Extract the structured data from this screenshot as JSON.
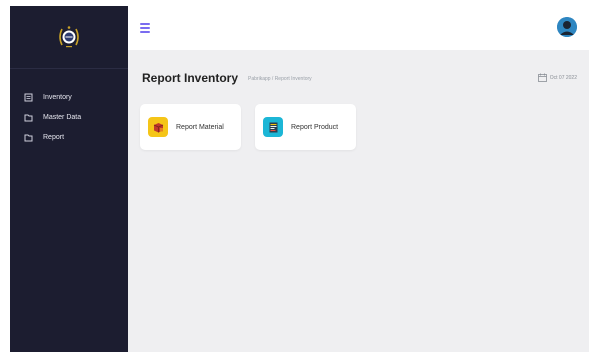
{
  "sidebar": {
    "items": [
      {
        "label": "Inventory",
        "icon": "file-icon"
      },
      {
        "label": "Master Data",
        "icon": "folder-icon"
      },
      {
        "label": "Report",
        "icon": "folder-icon"
      }
    ]
  },
  "topbar": {
    "menu_icon": "hamburger-icon",
    "avatar_icon": "user-avatar-icon"
  },
  "page": {
    "title": "Report Inventory",
    "breadcrumb": "Pabrikapp / Report Inventory",
    "date": "Oct 07 2022"
  },
  "cards": [
    {
      "label": "Report Material",
      "badge_color": "#f5c518"
    },
    {
      "label": "Report Product",
      "badge_color": "#1cb6d6"
    }
  ],
  "colors": {
    "sidebar_bg": "#1c1d30",
    "accent": "#7a6cf0",
    "content_bg": "#efeff1"
  }
}
